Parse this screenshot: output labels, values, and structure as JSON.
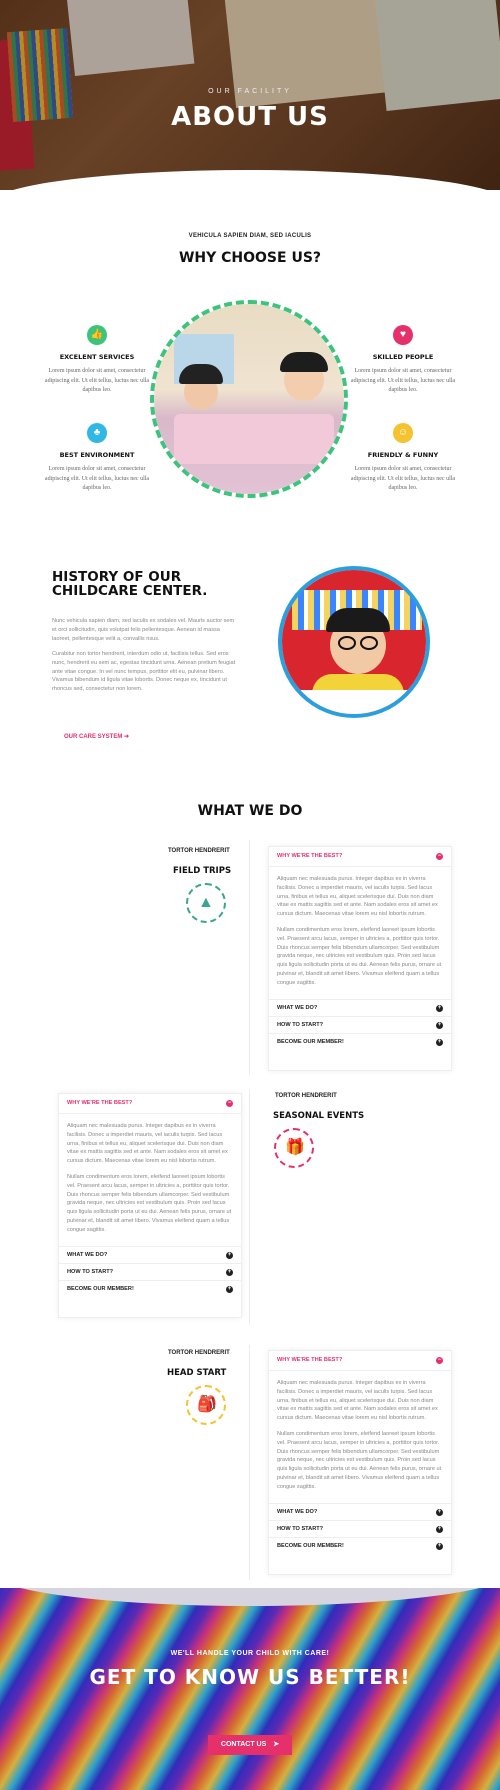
{
  "hero": {
    "eyebrow": "OUR FACILITY",
    "title": "ABOUT US"
  },
  "why": {
    "eyebrow": "VEHICULA SAPIEN DIAM, SED IACULIS",
    "title": "WHY CHOOSE US?",
    "features": [
      {
        "title": "EXCELENT SERVICES",
        "text": "Lorem ipsum dolor sit amet, consectetur adipiscing elit. Ut elit tellus, luctus nec ulla dapibus leo.",
        "icon": "thumbs-up-icon",
        "color": "#3cc47c"
      },
      {
        "title": "SKILLED PEOPLE",
        "text": "Lorem ipsum dolor sit amet, consectetur adipiscing elit. Ut elit tellus, luctus nec ulla dapibus leo.",
        "icon": "heart-icon",
        "color": "#e6306c"
      },
      {
        "title": "BEST ENVIRONMENT",
        "text": "Lorem ipsum dolor sit amet, consectetur adipiscing elit. Ut elit tellus, luctus nec ulla dapibus leo.",
        "icon": "tree-icon",
        "color": "#2fb8e6"
      },
      {
        "title": "FRIENDLY & FUNNY",
        "text": "Lorem ipsum dolor sit amet, consectetur adipiscing elit. Ut elit tellus, luctus nec ulla dapibus leo.",
        "icon": "smile-icon",
        "color": "#f5c230"
      }
    ]
  },
  "history": {
    "title_line1": "HISTORY OF OUR",
    "title_line2": "CHILDCARE CENTER.",
    "para1": "Nunc vehicula sapien diam, sed iaculis ex sodales vel. Mauris auctor sem et orci sollicitudin, quis volutpat felis pellentesque. Aenean id massa laoreet, pellentesque velit a, convallis risus.",
    "para2": "Curabitur non tortor hendrerit, interdum odio ut, facilisis tellus. Sed eros nunc, hendrerit eu sem ac, egestas tincidunt urna. Aenean pretium feugiat ante vitae congue. In vel nunc tempus, porttitor elit eu, pulvinar libero. Vivamus bibendum id ligula vitae lobortis. Donec neque ex, tincidunt ut rhoncus sed, consectetur non lorem.",
    "link": "OUR CARE SYSTEM ➜"
  },
  "whatwedo": {
    "title": "WHAT WE DO",
    "services": [
      {
        "label": "TORTOR HENDRERIT",
        "title": "FIELD TRIPS",
        "icon": "mountain-icon",
        "color": "#3aa58c"
      },
      {
        "label": "TORTOR HENDRERIT",
        "title": "SEASONAL EVENTS",
        "icon": "gift-icon",
        "color": "#e6306c"
      },
      {
        "label": "TORTOR HENDRERIT",
        "title": "HEAD START",
        "icon": "backpack-icon",
        "color": "#f5c230"
      }
    ],
    "accordion": {
      "open_title": "WHY WE'RE THE BEST?",
      "p1": "Aliquam nec malesuada purus. Integer dapibus ex in viverra facilisis. Donec a imperdiet mauris, vel iaculis turpis. Sed lacus urna, finibus et tellus eu, aliquet scelerisque dui. Duis non diam vitae ex mattis sagittis sed et ante. Nam sodales eros sit amet ex cursus dictum. Maecenas vitae lorem eu nisl lobortis rutrum.",
      "p2": "Nullam condimentum eros lorem, eleifend laoreet ipsum lobortis vel. Praesent arcu lacus, semper in ultricies a, porttitor quis tortor. Duis rhoncus semper felis bibendum ullamcorper. Sed vestibulum gravida neque, nec ultricies est vestibulum quis. Proin sed lacus quis ligula sollicitudin porta ut eu dui. Aenean felis purus, ornare ut pulvinar et, blandit sit amet libero. Vivamus eleifend quam a tellus congue sagittis.",
      "rows": [
        "WHAT WE DO?",
        "HOW TO START?",
        "BECOME OUR MEMBER!"
      ]
    }
  },
  "cta": {
    "eyebrow": "WE'LL HANDLE YOUR CHILD WITH CARE!",
    "title": "GET TO KNOW US BETTER!",
    "button": "CONTACT US"
  }
}
